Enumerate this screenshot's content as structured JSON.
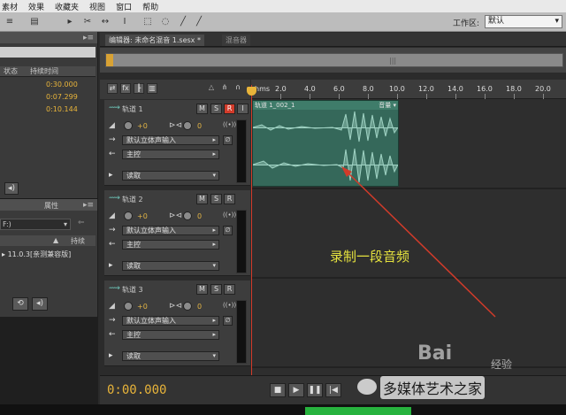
{
  "menu": [
    "素材",
    "效果",
    "收藏夹",
    "视图",
    "窗口",
    "帮助"
  ],
  "workspace": {
    "label": "工作区:",
    "value": "默认"
  },
  "files_panel": {
    "columns": [
      "状态",
      "持续时间"
    ],
    "rows": [
      {
        "duration": "0:30.000"
      },
      {
        "duration": "0:07.299"
      },
      {
        "duration": "0:10.144"
      }
    ]
  },
  "props_panel": {
    "tab_label": "属性",
    "drive": "F:)",
    "column": "持续",
    "row_text": "11.0.3[亲测兼容版]"
  },
  "editor": {
    "tabs": [
      "编辑器: 未命名混音 1.sesx *",
      "混音器"
    ]
  },
  "ruler": {
    "unit_label": "hms",
    "labels": [
      "2.0",
      "4.0",
      "6.0",
      "8.0",
      "10.0",
      "12.0",
      "14.0",
      "16.0",
      "18.0",
      "20.0"
    ]
  },
  "tracks": [
    {
      "name": "轨道 1",
      "volume": "+0",
      "pan": "0",
      "input": "默认立体声输入",
      "output": "主控",
      "read": "读取",
      "record_armed": true
    },
    {
      "name": "轨道 2",
      "volume": "+0",
      "pan": "0",
      "input": "默认立体声输入",
      "output": "主控",
      "read": "读取",
      "record_armed": false
    },
    {
      "name": "轨道 3",
      "volume": "+0",
      "pan": "0",
      "input": "默认立体声输入",
      "output": "主控",
      "read": "读取",
      "record_armed": false
    }
  ],
  "clip": {
    "name": "轨道 1_002_1",
    "label": "音量 ▾"
  },
  "annotation": "录制一段音频",
  "transport": {
    "time": "0:00.000"
  },
  "watermark": {
    "baidu": "Bai",
    "jingyan": "经验",
    "source": "多媒体艺术之家"
  },
  "colors": {
    "accent": "#e8b43a",
    "waveform": "#35685a",
    "record": "#d23b2a",
    "annotation": "#e5e23e"
  }
}
